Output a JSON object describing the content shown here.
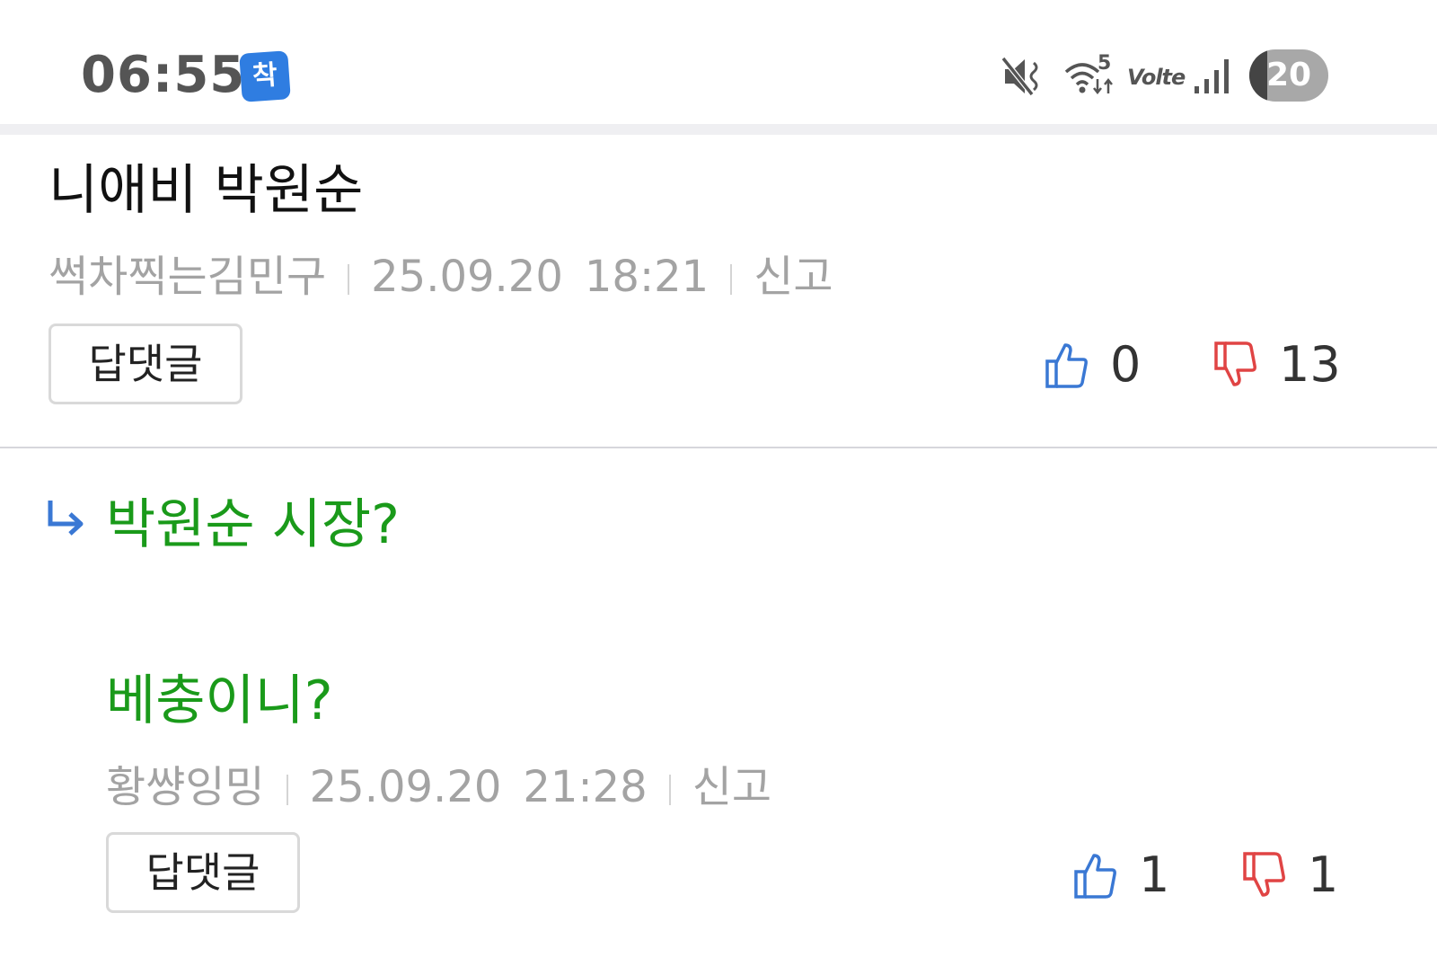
{
  "status_bar": {
    "time": "06:55",
    "app_badge": "착",
    "wifi_label": "5",
    "volte_label": "Volte",
    "battery": "20"
  },
  "comments": [
    {
      "text": "니애비 박원순",
      "author": "썩차찍는김민구",
      "date": "25.09.20",
      "time": "18:21",
      "report_label": "신고",
      "reply_label": "답댓글",
      "likes": "0",
      "dislikes": "13"
    }
  ],
  "replies": [
    {
      "text_line1": "박원순 시장?",
      "text_line2": "베충이니?",
      "author": "황썅잉밍",
      "date": "25.09.20",
      "time": "21:28",
      "report_label": "신고",
      "reply_label": "답댓글",
      "likes": "1",
      "dislikes": "1"
    }
  ],
  "colors": {
    "reply_text": "#1a9a1a",
    "like_icon": "#3a78d4",
    "dislike_icon": "#e04444",
    "meta_text": "#a3a3a3"
  },
  "icons": [
    "mute-icon",
    "wifi-icon",
    "signal-icon",
    "thumbs-up-icon",
    "thumbs-down-icon",
    "reply-arrow-icon"
  ]
}
